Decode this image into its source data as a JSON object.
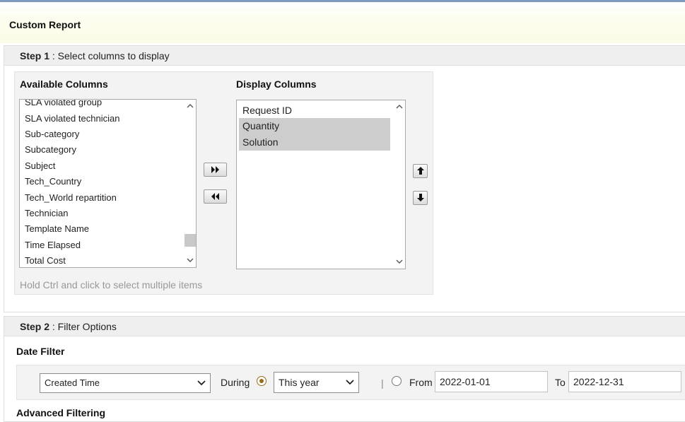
{
  "page": {
    "title": "Custom Report"
  },
  "step1": {
    "step_label": "Step 1",
    "header_text": " : Select columns to display",
    "available_heading": "Available Columns",
    "display_heading": "Display Columns",
    "available_items": [
      "SLA violated group",
      "SLA violated technician",
      "Sub-category",
      "Subcategory",
      "Subject",
      "Tech_Country",
      "Tech_World repartition",
      "Technician",
      "Template Name",
      "Time Elapsed",
      "Total Cost"
    ],
    "display_items": [
      "Request ID",
      "Quantity",
      "Solution"
    ],
    "selected_display_items": [
      "Quantity",
      "Solution"
    ],
    "hint": "Hold Ctrl and click to select multiple items",
    "buttons": {
      "add": "»",
      "remove": "«",
      "move_up": "🡅",
      "move_down": "🡇"
    }
  },
  "step2": {
    "step_label": "Step 2",
    "header_text": " : Filter Options",
    "date_filter_heading": "Date Filter",
    "date_field_value": "Created Time",
    "during_label": "During",
    "period_value": "This year",
    "separator": "|",
    "from_label": "From",
    "from_value": "2022-01-01",
    "to_label": "To",
    "to_value": "2022-12-31",
    "selected_mode": "during",
    "advanced_heading": "Advanced Filtering"
  },
  "colors": {
    "accent_line": "#7f9cc0",
    "header_bg": "#efefef",
    "selection_bg": "#cdcdcd",
    "radio_selected": "#9a6a1a"
  }
}
